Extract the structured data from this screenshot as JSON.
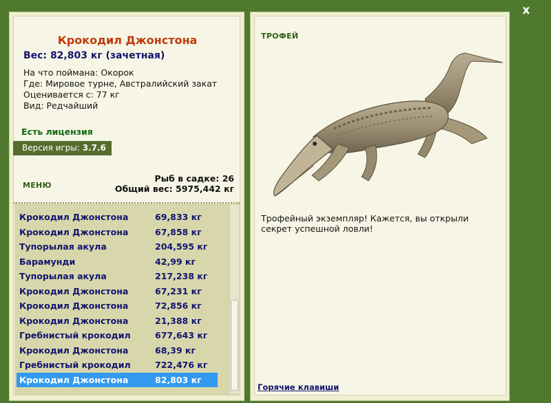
{
  "close_label": "x",
  "fish": {
    "title": "Крокодил Джонстона",
    "weight": "Вес: 82,803 кг (зачетная)",
    "caught_on": "На что поймана: Окорок",
    "where": "Где: Мировое турне, Австралийский закат",
    "valued_from": "Оценивается с: 77 кг",
    "kind": "Вид: Редчайший"
  },
  "license": "Есть лицензия",
  "version": {
    "label": "Версия игры:",
    "number": "3.7.6"
  },
  "menu_label": "МЕНЮ",
  "stats": {
    "fish_in_keepnet": "Рыб в садке: 26",
    "total_weight": "Общий вес: 5975,442 кг"
  },
  "catch_list": [
    {
      "name": "Крокодил Джонстона",
      "weight": "69,833 кг"
    },
    {
      "name": "Крокодил Джонстона",
      "weight": "67,858 кг"
    },
    {
      "name": "Тупорылая акула",
      "weight": "204,595 кг"
    },
    {
      "name": "Барамунди",
      "weight": "42,99 кг"
    },
    {
      "name": "Тупорылая акула",
      "weight": "217,238 кг"
    },
    {
      "name": "Крокодил Джонстона",
      "weight": "67,231 кг"
    },
    {
      "name": "Крокодил Джонстона",
      "weight": "72,856 кг"
    },
    {
      "name": "Крокодил Джонстона",
      "weight": "21,388 кг"
    },
    {
      "name": "Гребнистый крокодил",
      "weight": "677,643 кг"
    },
    {
      "name": "Крокодил Джонстона",
      "weight": "68,39 кг"
    },
    {
      "name": "Гребнистый крокодил",
      "weight": "722,476 кг"
    },
    {
      "name": "Крокодил Джонстона",
      "weight": "82,803 кг",
      "selected": true
    }
  ],
  "trophy": {
    "label": "ТРОФЕЙ",
    "text": "Трофейный экземпляр! Кажется, вы открыли секрет успешной ловли!",
    "image_icon": "crocodile-image"
  },
  "hotkeys_label": "Горячие клавиши",
  "colors": {
    "background": "#4f7a2e",
    "panel": "#f7f6e6",
    "title": "#bf3a0b",
    "weight": "#14136e",
    "license": "#0f6a12",
    "version_bar": "#556d2c",
    "list_bg": "#d7d7ab",
    "list_text": "#13136e",
    "selected_row": "#3399f1"
  }
}
